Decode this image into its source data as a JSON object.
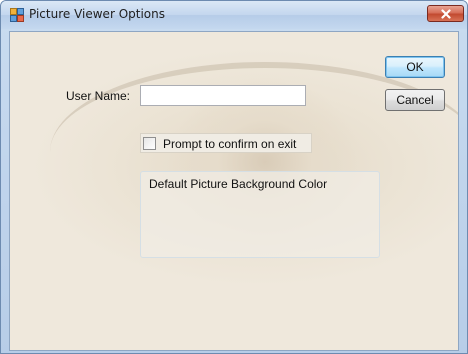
{
  "window": {
    "title": "Picture Viewer Options",
    "icon": "app-window-icon",
    "close_icon": "close-icon",
    "close_color": "#c9452d"
  },
  "form": {
    "user_name_label": "User Name:",
    "user_name_value": "",
    "prompt_checkbox_label": "Prompt to confirm on exit",
    "prompt_checkbox_checked": false,
    "group_title": "Default Picture Background Color"
  },
  "buttons": {
    "ok": "OK",
    "cancel": "Cancel"
  },
  "colors": {
    "default_button_border": "#3c7fb1",
    "titlebar": "#c3d6ee"
  }
}
